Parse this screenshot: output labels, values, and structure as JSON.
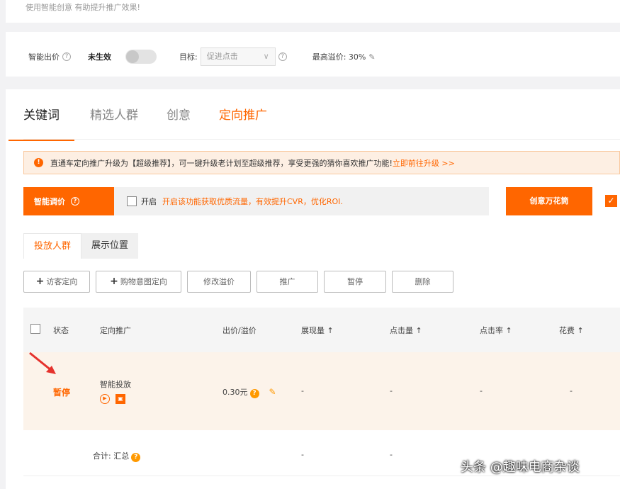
{
  "top_hint": "使用智能创意 有助提升推广效果!",
  "bid": {
    "label": "智能出价",
    "status": "未生效",
    "goal_label": "目标:",
    "goal_value": "促进点击",
    "max_label": "最高溢价: 30%"
  },
  "tabs": [
    "关键词",
    "精选人群",
    "创意",
    "定向推广"
  ],
  "notice": {
    "text": "直通车定向推广升级为【超级推荐】，可一键升级老计划至超级推荐，享受更强的猜你喜欢推广功能!",
    "link": "立即前往升级 >>"
  },
  "smart": {
    "label": "智能调价",
    "open_label": "开启",
    "desc": "开启该功能获取优质流量，有效提升CVR，优化ROI.",
    "creative_label": "创意万花筒"
  },
  "subtabs": [
    "投放人群",
    "展示位置"
  ],
  "actions": [
    "访客定向",
    "购物意图定向",
    "修改溢价",
    "推广",
    "暂停",
    "删除"
  ],
  "table": {
    "headers": [
      "状态",
      "定向推广",
      "出价/溢价",
      "展现量 ↑",
      "点击量 ↑",
      "点击率 ↑",
      "花费 ↑"
    ],
    "row": {
      "status": "暂停",
      "name": "智能投放",
      "bid": "0.30元",
      "impressions": "-",
      "clicks": "-",
      "ctr": "-",
      "cost": "-"
    },
    "total": {
      "label": "合计: 汇总",
      "impressions": "-",
      "clicks": "-"
    }
  },
  "watermark": "头条 @趣味电商杂谈",
  "colors": {
    "accent": "#ff6600",
    "notice_bg": "#fdefe3"
  }
}
